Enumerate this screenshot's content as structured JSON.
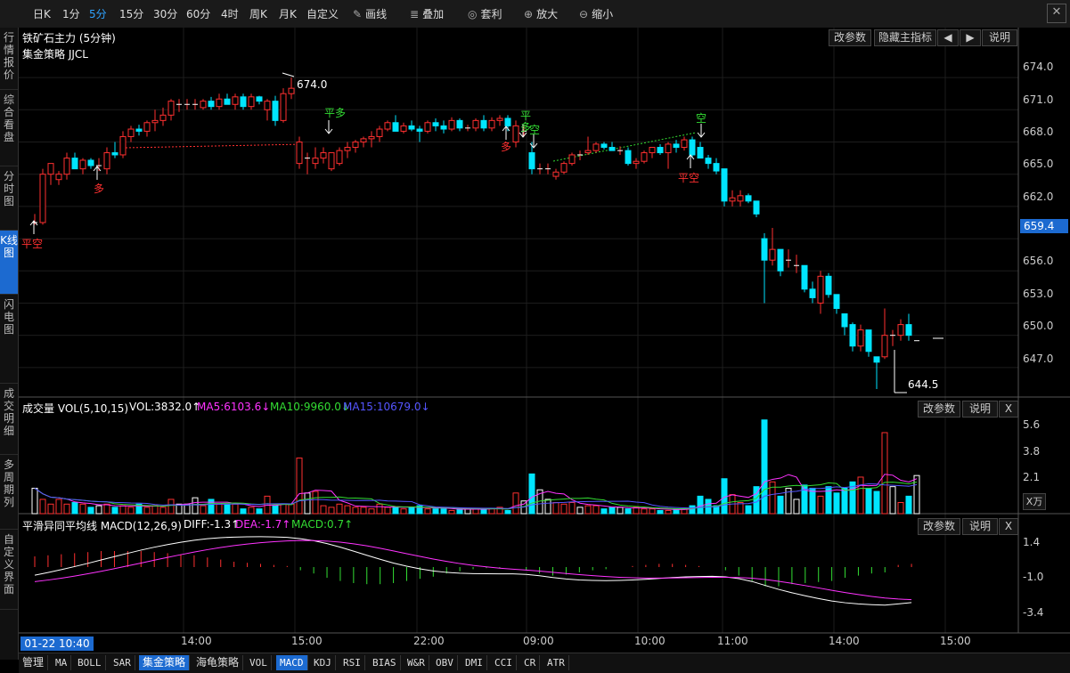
{
  "toolbar": {
    "periods": [
      "日K",
      "1分",
      "5分",
      "15分",
      "30分",
      "60分",
      "4时",
      "周K",
      "月K",
      "自定义"
    ],
    "active_period": "5分",
    "tools": [
      {
        "icon": "pencil-icon",
        "label": "画线"
      },
      {
        "icon": "layers-icon",
        "label": "叠加"
      },
      {
        "icon": "coin-icon",
        "label": "套利"
      },
      {
        "icon": "zoom-in-icon",
        "label": "放大"
      },
      {
        "icon": "zoom-out-icon",
        "label": "缩小"
      }
    ],
    "close": "✕"
  },
  "left_tabs": [
    "行情报价",
    "综合看盘",
    "分时图",
    "K线图",
    "闪电图",
    "成交明细",
    "多周期列",
    "自定义界面"
  ],
  "left_active": "K线图",
  "main_panel": {
    "title": "铁矿石主力 (5分钟)",
    "strategy": "集金策略 JJCL",
    "buttons": [
      "改参数",
      "隐藏主指标",
      "◀",
      "▶",
      "说明"
    ],
    "high_label": "674.0",
    "low_label": "644.5",
    "current_price": "659.4",
    "y_ticks": [
      "674.0",
      "671.0",
      "668.0",
      "665.0",
      "662.0",
      "659.0",
      "656.0",
      "653.0",
      "650.0",
      "647.0"
    ],
    "signals": [
      {
        "text": "平空",
        "color": "#ff3030"
      },
      {
        "text": "多",
        "color": "#ff3030"
      },
      {
        "text": "平多",
        "color": "#33dd33"
      },
      {
        "text": "多",
        "color": "#ff3030"
      },
      {
        "text": "平多",
        "color": "#33dd33"
      },
      {
        "text": "空",
        "color": "#33dd33"
      },
      {
        "text": "空",
        "color": "#33dd33"
      },
      {
        "text": "平空",
        "color": "#ff3030"
      }
    ]
  },
  "vol_panel": {
    "title": "成交量 VOL(5,10,15)",
    "vol": "VOL:3832.0↑",
    "ma5": "MA5:6103.6↓",
    "ma10": "MA10:9960.0↓",
    "ma15": "MA15:10679.0↓",
    "buttons": [
      "改参数",
      "说明",
      "X"
    ],
    "y_ticks": [
      "5.6",
      "3.8",
      "2.1"
    ],
    "unit": "X万"
  },
  "macd_panel": {
    "title": "平滑异同平均线 MACD(12,26,9)",
    "diff": "DIFF:-1.3↑",
    "dea": "DEA:-1.7↑",
    "macd": "MACD:0.7↑",
    "buttons": [
      "改参数",
      "说明",
      "X"
    ],
    "y_ticks": [
      "1.4",
      "-1.0",
      "-3.4"
    ]
  },
  "x_axis": {
    "date": "01-22 10:40",
    "labels": [
      "14:00",
      "15:00",
      "22:00",
      "09:00",
      "10:00",
      "11:00",
      "14:00",
      "15:00"
    ]
  },
  "bottom_tabs": [
    "管理",
    "MA",
    "BOLL",
    "SAR",
    "集金策略",
    "海龟策略",
    "VOL",
    "MACD",
    "KDJ",
    "RSI",
    "BIAS",
    "W&R",
    "OBV",
    "DMI",
    "CCI",
    "CR",
    "ATR"
  ],
  "bottom_active": [
    "集金策略",
    "MACD"
  ],
  "colors": {
    "up": "#ff3030",
    "down": "#00e5ff",
    "accent": "#1c6ad0",
    "diff": "#ffffff",
    "dea": "#ff33ff",
    "ma5": "#ff33ff",
    "ma10": "#33dd33",
    "ma15": "#3333ff"
  },
  "chart_data": {
    "type": "candlestick",
    "y_range": [
      645.0,
      675.5
    ],
    "candles": [
      {
        "o": 660.5,
        "h": 661.3,
        "l": 660.3,
        "c": 660.5
      },
      {
        "o": 660.5,
        "h": 665.5,
        "l": 660.3,
        "c": 665.0
      },
      {
        "o": 665.0,
        "h": 666.0,
        "l": 664.0,
        "c": 666.0
      },
      {
        "o": 664.5,
        "h": 665.3,
        "l": 664.0,
        "c": 665.0
      },
      {
        "o": 665.0,
        "h": 667.0,
        "l": 664.5,
        "c": 666.5
      },
      {
        "o": 666.5,
        "h": 667.0,
        "l": 665.5,
        "c": 665.5
      },
      {
        "o": 665.5,
        "h": 666.5,
        "l": 665.0,
        "c": 666.3
      },
      {
        "o": 666.3,
        "h": 666.5,
        "l": 665.5,
        "c": 665.8
      },
      {
        "o": 665.8,
        "h": 666.5,
        "l": 665.3,
        "c": 665.8
      },
      {
        "o": 665.5,
        "h": 667.5,
        "l": 665.0,
        "c": 667.0
      },
      {
        "o": 667.0,
        "h": 668.0,
        "l": 666.5,
        "c": 666.8
      },
      {
        "o": 666.8,
        "h": 669.0,
        "l": 666.5,
        "c": 668.5
      },
      {
        "o": 668.5,
        "h": 669.5,
        "l": 668.0,
        "c": 669.2
      },
      {
        "o": 669.2,
        "h": 669.6,
        "l": 668.6,
        "c": 669.0
      },
      {
        "o": 669.0,
        "h": 670.0,
        "l": 668.5,
        "c": 669.8
      },
      {
        "o": 669.8,
        "h": 671.0,
        "l": 669.0,
        "c": 670.0
      },
      {
        "o": 670.0,
        "h": 671.2,
        "l": 669.5,
        "c": 670.5
      },
      {
        "o": 670.5,
        "h": 672.0,
        "l": 670.0,
        "c": 671.8
      },
      {
        "o": 671.5,
        "h": 672.0,
        "l": 670.8,
        "c": 671.5
      },
      {
        "o": 671.5,
        "h": 672.0,
        "l": 671.0,
        "c": 671.5
      },
      {
        "o": 671.5,
        "h": 672.0,
        "l": 671.0,
        "c": 671.5
      },
      {
        "o": 671.2,
        "h": 672.0,
        "l": 671.0,
        "c": 671.8
      },
      {
        "o": 671.8,
        "h": 672.2,
        "l": 671.0,
        "c": 671.3
      },
      {
        "o": 671.3,
        "h": 672.5,
        "l": 671.0,
        "c": 672.0
      },
      {
        "o": 672.0,
        "h": 672.5,
        "l": 671.5,
        "c": 671.5
      },
      {
        "o": 671.5,
        "h": 672.5,
        "l": 671.0,
        "c": 672.2
      },
      {
        "o": 672.2,
        "h": 672.5,
        "l": 671.0,
        "c": 671.3
      },
      {
        "o": 671.3,
        "h": 672.5,
        "l": 671.0,
        "c": 672.2
      },
      {
        "o": 672.2,
        "h": 672.3,
        "l": 671.5,
        "c": 671.8
      },
      {
        "o": 671.0,
        "h": 672.0,
        "l": 670.0,
        "c": 671.8
      },
      {
        "o": 671.8,
        "h": 672.3,
        "l": 669.5,
        "c": 670.0
      },
      {
        "o": 670.0,
        "h": 673.0,
        "l": 669.8,
        "c": 672.5
      },
      {
        "o": 672.5,
        "h": 674.0,
        "l": 672.0,
        "c": 673.0
      },
      {
        "o": 666.0,
        "h": 668.5,
        "l": 665.5,
        "c": 668.0
      },
      {
        "o": 666.5,
        "h": 667.0,
        "l": 665.0,
        "c": 666.5
      },
      {
        "o": 666.0,
        "h": 667.5,
        "l": 665.5,
        "c": 666.5
      },
      {
        "o": 666.5,
        "h": 667.5,
        "l": 666.0,
        "c": 667.0
      },
      {
        "o": 665.5,
        "h": 667.0,
        "l": 665.3,
        "c": 667.0
      },
      {
        "o": 666.0,
        "h": 667.5,
        "l": 665.8,
        "c": 667.2
      },
      {
        "o": 667.2,
        "h": 668.0,
        "l": 666.5,
        "c": 667.5
      },
      {
        "o": 667.5,
        "h": 668.2,
        "l": 667.0,
        "c": 668.0
      },
      {
        "o": 668.0,
        "h": 668.5,
        "l": 667.5,
        "c": 668.3
      },
      {
        "o": 668.3,
        "h": 669.0,
        "l": 667.5,
        "c": 668.5
      },
      {
        "o": 668.5,
        "h": 669.5,
        "l": 668.0,
        "c": 669.2
      },
      {
        "o": 669.2,
        "h": 670.0,
        "l": 669.0,
        "c": 669.8
      },
      {
        "o": 669.8,
        "h": 670.5,
        "l": 669.0,
        "c": 669.0
      },
      {
        "o": 669.0,
        "h": 669.8,
        "l": 668.8,
        "c": 669.5
      },
      {
        "o": 669.5,
        "h": 670.0,
        "l": 669.0,
        "c": 669.2
      },
      {
        "o": 669.2,
        "h": 669.5,
        "l": 668.0,
        "c": 669.0
      },
      {
        "o": 669.0,
        "h": 670.0,
        "l": 668.8,
        "c": 669.8
      },
      {
        "o": 669.8,
        "h": 670.2,
        "l": 669.0,
        "c": 669.5
      },
      {
        "o": 669.5,
        "h": 670.0,
        "l": 668.8,
        "c": 669.2
      },
      {
        "o": 669.2,
        "h": 670.3,
        "l": 669.0,
        "c": 670.0
      },
      {
        "o": 670.0,
        "h": 670.2,
        "l": 669.0,
        "c": 669.3
      },
      {
        "o": 669.3,
        "h": 669.6,
        "l": 669.0,
        "c": 669.3
      },
      {
        "o": 669.3,
        "h": 670.2,
        "l": 669.0,
        "c": 670.0
      },
      {
        "o": 670.0,
        "h": 670.5,
        "l": 669.0,
        "c": 669.3
      },
      {
        "o": 669.3,
        "h": 670.3,
        "l": 669.0,
        "c": 670.0
      },
      {
        "o": 670.0,
        "h": 670.5,
        "l": 669.5,
        "c": 670.2
      },
      {
        "o": 670.2,
        "h": 670.5,
        "l": 669.0,
        "c": 669.5
      },
      {
        "o": 668.0,
        "h": 670.0,
        "l": 667.5,
        "c": 669.5
      },
      {
        "o": 669.0,
        "h": 669.5,
        "l": 668.5,
        "c": 669.0
      },
      {
        "o": 667.0,
        "h": 668.0,
        "l": 665.0,
        "c": 665.5
      },
      {
        "o": 665.5,
        "h": 666.0,
        "l": 665.0,
        "c": 665.5
      },
      {
        "o": 665.5,
        "h": 666.0,
        "l": 665.0,
        "c": 665.5
      },
      {
        "o": 664.8,
        "h": 665.5,
        "l": 664.5,
        "c": 665.2
      },
      {
        "o": 665.2,
        "h": 666.2,
        "l": 665.0,
        "c": 666.0
      },
      {
        "o": 666.0,
        "h": 667.0,
        "l": 665.8,
        "c": 666.8
      },
      {
        "o": 666.8,
        "h": 667.2,
        "l": 666.3,
        "c": 666.8
      },
      {
        "o": 667.0,
        "h": 668.5,
        "l": 666.8,
        "c": 667.2
      },
      {
        "o": 667.2,
        "h": 668.0,
        "l": 667.0,
        "c": 667.8
      },
      {
        "o": 667.8,
        "h": 668.0,
        "l": 667.3,
        "c": 667.5
      },
      {
        "o": 667.5,
        "h": 668.0,
        "l": 667.2,
        "c": 667.2
      },
      {
        "o": 667.2,
        "h": 667.6,
        "l": 666.8,
        "c": 667.2
      },
      {
        "o": 667.2,
        "h": 667.5,
        "l": 665.8,
        "c": 666.0
      },
      {
        "o": 666.0,
        "h": 666.5,
        "l": 665.5,
        "c": 666.2
      },
      {
        "o": 666.2,
        "h": 667.2,
        "l": 666.0,
        "c": 667.0
      },
      {
        "o": 667.0,
        "h": 667.5,
        "l": 666.5,
        "c": 667.5
      },
      {
        "o": 667.5,
        "h": 667.8,
        "l": 666.8,
        "c": 667.0
      },
      {
        "o": 667.0,
        "h": 668.0,
        "l": 665.5,
        "c": 667.8
      },
      {
        "o": 667.8,
        "h": 668.2,
        "l": 667.0,
        "c": 667.5
      },
      {
        "o": 667.5,
        "h": 668.5,
        "l": 667.2,
        "c": 668.2
      },
      {
        "o": 668.2,
        "h": 668.5,
        "l": 666.5,
        "c": 666.8
      },
      {
        "o": 667.5,
        "h": 668.0,
        "l": 666.5,
        "c": 666.5
      },
      {
        "o": 666.5,
        "h": 666.8,
        "l": 665.5,
        "c": 666.0
      },
      {
        "o": 666.0,
        "h": 666.5,
        "l": 665.0,
        "c": 665.3
      },
      {
        "o": 665.5,
        "h": 665.5,
        "l": 662.0,
        "c": 662.5
      },
      {
        "o": 662.5,
        "h": 663.5,
        "l": 662.0,
        "c": 662.8
      },
      {
        "o": 662.5,
        "h": 663.5,
        "l": 662.0,
        "c": 663.0
      },
      {
        "o": 663.0,
        "h": 663.2,
        "l": 662.3,
        "c": 662.5
      },
      {
        "o": 662.5,
        "h": 662.5,
        "l": 661.0,
        "c": 661.3
      },
      {
        "o": 659.0,
        "h": 659.5,
        "l": 653.0,
        "c": 657.0
      },
      {
        "o": 657.0,
        "h": 660.0,
        "l": 656.5,
        "c": 658.0
      },
      {
        "o": 658.0,
        "h": 658.0,
        "l": 655.5,
        "c": 656.0
      },
      {
        "o": 657.0,
        "h": 658.0,
        "l": 656.3,
        "c": 657.0
      },
      {
        "o": 656.5,
        "h": 657.5,
        "l": 655.8,
        "c": 656.5
      },
      {
        "o": 656.5,
        "h": 656.5,
        "l": 654.0,
        "c": 654.3
      },
      {
        "o": 654.3,
        "h": 655.0,
        "l": 653.0,
        "c": 653.5
      },
      {
        "o": 653.0,
        "h": 656.0,
        "l": 652.0,
        "c": 655.5
      },
      {
        "o": 655.5,
        "h": 655.8,
        "l": 653.5,
        "c": 653.8
      },
      {
        "o": 653.8,
        "h": 653.8,
        "l": 652.0,
        "c": 652.5
      },
      {
        "o": 652.0,
        "h": 652.0,
        "l": 650.0,
        "c": 650.8
      },
      {
        "o": 651.0,
        "h": 651.2,
        "l": 648.5,
        "c": 649.0
      },
      {
        "o": 649.0,
        "h": 651.0,
        "l": 648.5,
        "c": 650.5
      },
      {
        "o": 650.5,
        "h": 650.5,
        "l": 648.0,
        "c": 648.5
      },
      {
        "o": 648.0,
        "h": 648.0,
        "l": 645.0,
        "c": 647.5
      },
      {
        "o": 648.0,
        "h": 652.5,
        "l": 647.8,
        "c": 650.0
      },
      {
        "o": 650.0,
        "h": 650.5,
        "l": 649.0,
        "c": 650.0
      },
      {
        "o": 650.0,
        "h": 651.5,
        "l": 649.5,
        "c": 651.0
      },
      {
        "o": 651.0,
        "h": 652.0,
        "l": 649.5,
        "c": 650.0
      },
      {
        "o": 649.5,
        "h": 649.5,
        "l": 649.5,
        "c": 649.5
      }
    ],
    "volumes": [
      1.6,
      0.9,
      0.6,
      0.9,
      0.6,
      0.7,
      0.6,
      0.4,
      0.5,
      0.6,
      0.4,
      0.5,
      0.4,
      0.6,
      0.4,
      0.5,
      0.4,
      0.9,
      0.6,
      0.6,
      1.0,
      0.5,
      0.9,
      0.6,
      0.6,
      0.6,
      0.3,
      0.4,
      0.3,
      1.1,
      0.5,
      0.6,
      0.6,
      3.5,
      1.3,
      1.4,
      0.5,
      0.4,
      0.6,
      0.5,
      0.4,
      0.4,
      0.3,
      0.6,
      0.4,
      0.4,
      0.3,
      0.4,
      0.5,
      0.3,
      0.3,
      0.3,
      0.2,
      0.3,
      0.3,
      0.3,
      0.3,
      0.3,
      0.4,
      0.2,
      1.3,
      0.8,
      2.5,
      1.5,
      0.9,
      0.7,
      0.6,
      0.7,
      0.4,
      0.5,
      0.5,
      0.3,
      0.4,
      0.4,
      0.3,
      0.4,
      0.3,
      0.3,
      0.2,
      0.2,
      0.3,
      0.3,
      0.5,
      1.1,
      0.9,
      0.5,
      2.2,
      1.2,
      0.7,
      0.5,
      1.7,
      5.9,
      2.0,
      1.1,
      1.6,
      0.9,
      1.8,
      1.6,
      1.1,
      1.7,
      1.3,
      1.6,
      2.0,
      2.3,
      1.6,
      1.4,
      5.1,
      1.7,
      0.7,
      1.1,
      2.4
    ],
    "macd_hist": [
      1.0,
      1.1,
      1.2,
      1.3,
      1.4,
      1.5,
      1.5,
      1.5,
      1.5,
      1.4,
      1.3,
      1.2,
      1.1,
      0.9,
      0.7,
      0.5,
      0.4,
      0.3,
      0.2,
      0.1,
      -0.3,
      -0.6,
      -1.0,
      -1.3,
      -1.5,
      -1.6,
      -1.6,
      -1.5,
      -1.3,
      -1.1,
      -0.9,
      -0.6,
      -0.4,
      -0.2,
      -0.1,
      -0.1,
      0.0,
      -0.3,
      -0.6,
      -0.8,
      -0.7,
      -0.5,
      -0.3,
      -0.2,
      0.0,
      0.1,
      0.2,
      0.3,
      0.3,
      0.2,
      0.1,
      0.0,
      -0.3,
      -0.8,
      -1.3,
      -1.8,
      -1.8,
      -1.6,
      -1.5,
      -1.4,
      -1.3,
      -1.0,
      -0.8,
      -0.6,
      -0.5,
      0.2,
      0.3
    ]
  }
}
